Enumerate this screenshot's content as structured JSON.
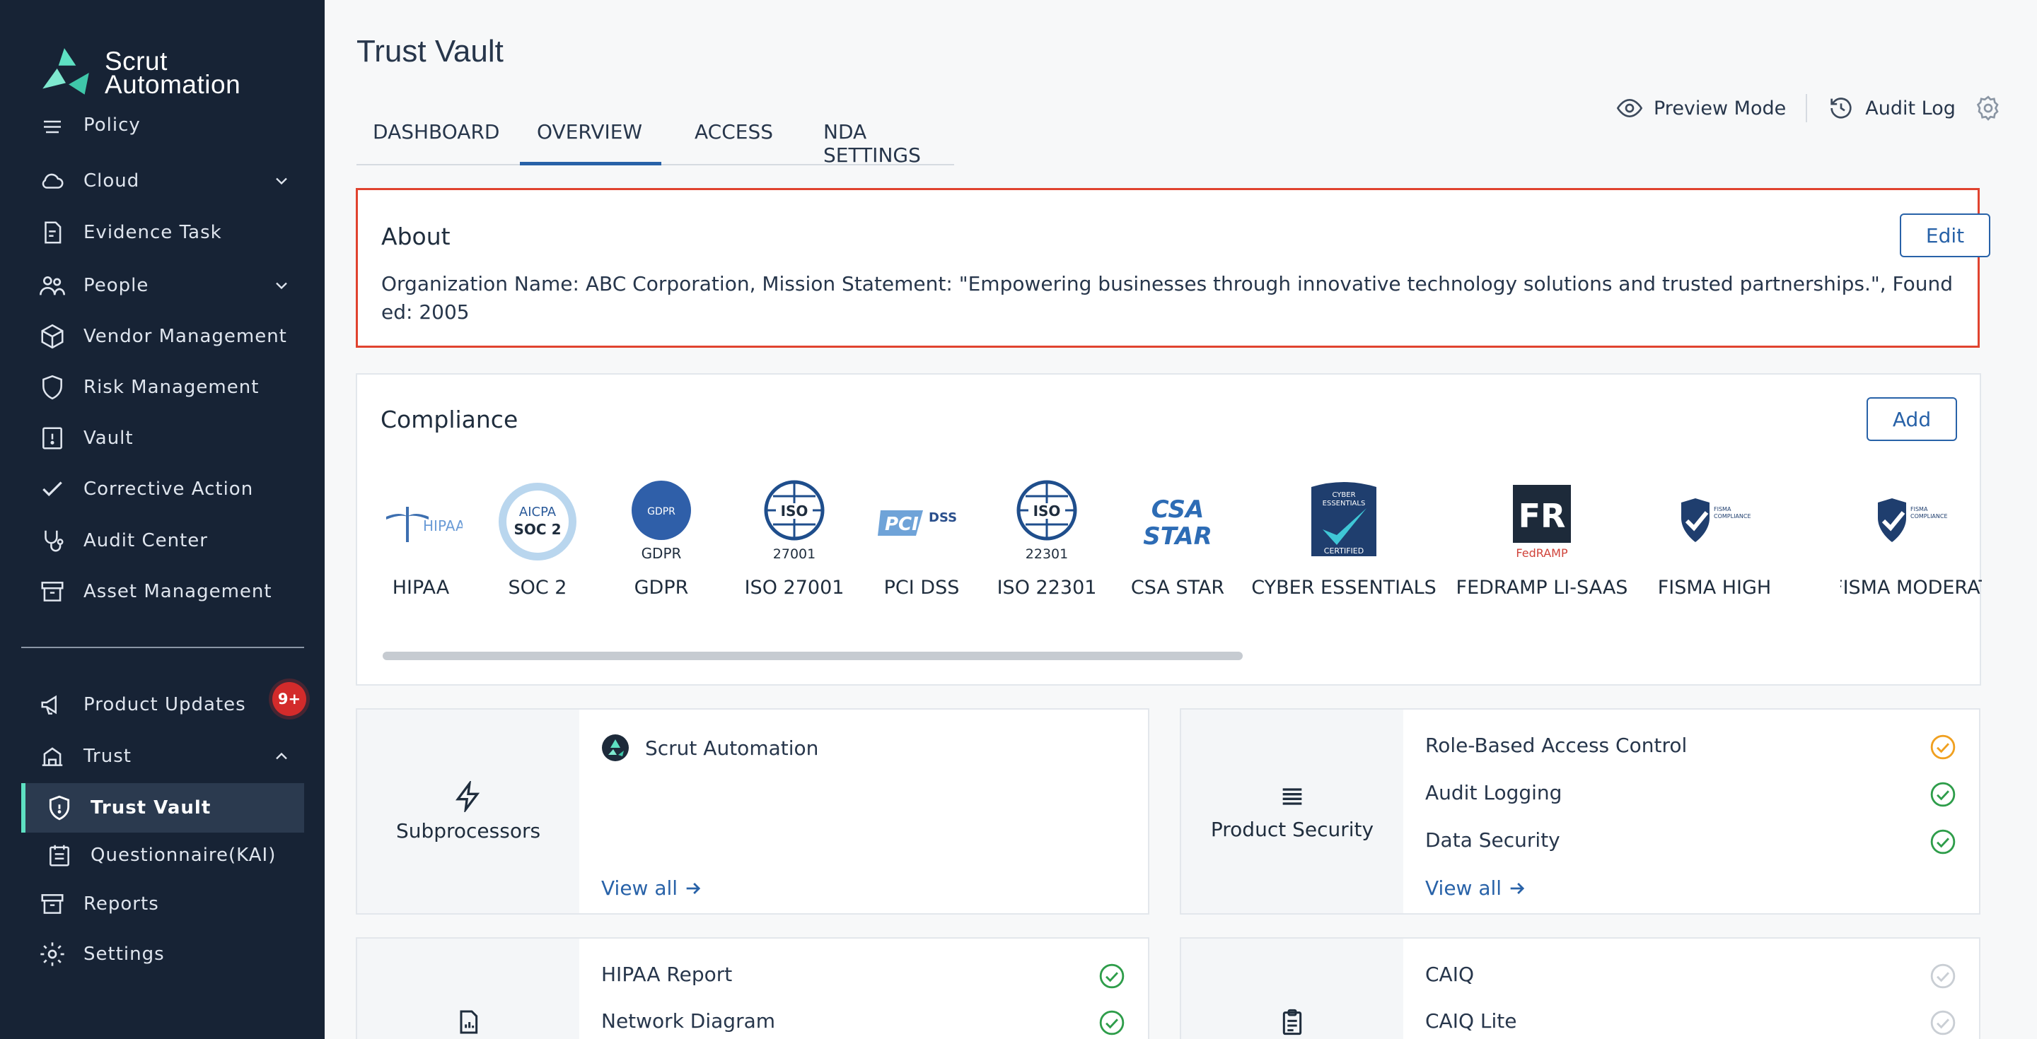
{
  "brand": {
    "line1": "Scrut",
    "line2": "Automation"
  },
  "sidebar": {
    "items": [
      {
        "label": "Policy",
        "icon": "policy-icon"
      },
      {
        "label": "Cloud",
        "icon": "cloud-icon",
        "expandable": true
      },
      {
        "label": "Evidence Task",
        "icon": "evidence-task-icon"
      },
      {
        "label": "People",
        "icon": "people-icon",
        "expandable": true
      },
      {
        "label": "Vendor Management",
        "icon": "vendor-icon"
      },
      {
        "label": "Risk Management",
        "icon": "shield-icon"
      },
      {
        "label": "Vault",
        "icon": "vault-icon"
      },
      {
        "label": "Corrective Action",
        "icon": "check-icon"
      },
      {
        "label": "Audit Center",
        "icon": "stethoscope-icon"
      },
      {
        "label": "Asset Management",
        "icon": "archive-icon"
      }
    ],
    "bottom": [
      {
        "label": "Product Updates",
        "icon": "megaphone-icon",
        "badge": "9+"
      },
      {
        "label": "Trust",
        "icon": "trust-icon",
        "expanded": true
      },
      {
        "label": "Trust Vault",
        "icon": "shield-lock-icon",
        "active": true
      },
      {
        "label": "Questionnaire(KAI)",
        "icon": "calendar-icon"
      },
      {
        "label": "Reports",
        "icon": "archive-icon"
      },
      {
        "label": "Settings",
        "icon": "gear-icon"
      }
    ]
  },
  "page": {
    "title": "Trust Vault"
  },
  "tabs": [
    "DASHBOARD",
    "OVERVIEW",
    "ACCESS",
    "NDA SETTINGS"
  ],
  "active_tab": "OVERVIEW",
  "top_actions": {
    "preview": "Preview Mode",
    "audit_log": "Audit Log"
  },
  "about": {
    "title": "About",
    "edit_label": "Edit",
    "text": "Organization Name: ABC Corporation, Mission Statement: \"Empowering businesses through innovative technology solutions and trusted partnerships.\", Founded: 2005"
  },
  "compliance": {
    "title": "Compliance",
    "add_label": "Add",
    "certs": [
      {
        "label": "HIPAA",
        "logo_text": "HIPAA"
      },
      {
        "label": "SOC 2",
        "logo_text": "AICPA",
        "logo_sub": "SOC 2"
      },
      {
        "label": "GDPR",
        "logo_text": "GDPR",
        "logo_sub": "GDPR"
      },
      {
        "label": "ISO 27001",
        "logo_text": "ISO",
        "logo_sub": "27001"
      },
      {
        "label": "PCI DSS",
        "logo_text": "PCI",
        "logo_sub": "DSS"
      },
      {
        "label": "ISO 22301",
        "logo_text": "ISO",
        "logo_sub": "22301"
      },
      {
        "label": "CSA STAR",
        "logo_text": "CSA",
        "logo_sub": "STAR"
      },
      {
        "label": "CYBER ESSENTIALS",
        "logo_text": "CYBER ESSENTIALS",
        "logo_sub": "CERTIFIED"
      },
      {
        "label": "FEDRAMP LI-SAAS",
        "logo_text": "FR",
        "logo_sub": "FedRAMP"
      },
      {
        "label": "FISMA HIGH",
        "logo_text": "FISMA COMPLIANCE"
      },
      {
        "label": "FISMA MODERAT",
        "logo_text": "FISMA COMPLIANCE"
      }
    ]
  },
  "subprocessors": {
    "title": "Subprocessors",
    "items": [
      "Scrut Automation"
    ],
    "view_all": "View all"
  },
  "product_security": {
    "title": "Product Security",
    "items": [
      {
        "label": "Role-Based Access Control",
        "status": "pending",
        "color": "#f0a020"
      },
      {
        "label": "Audit Logging",
        "status": "done",
        "color": "#2e9d4a"
      },
      {
        "label": "Data Security",
        "status": "done",
        "color": "#2e9d4a"
      }
    ],
    "view_all": "View all"
  },
  "documents": {
    "items": [
      {
        "label": "HIPAA Report",
        "status": "done"
      },
      {
        "label": "Network Diagram",
        "status": "done"
      }
    ]
  },
  "questionnaires": {
    "items": [
      {
        "label": "CAIQ",
        "status": "inactive"
      },
      {
        "label": "CAIQ Lite",
        "status": "inactive"
      }
    ]
  },
  "colors": {
    "accent": "#2862a8",
    "sidebar": "#172335",
    "highlight": "#e0432f",
    "success": "#2e9d4a",
    "warning": "#f0a020"
  }
}
